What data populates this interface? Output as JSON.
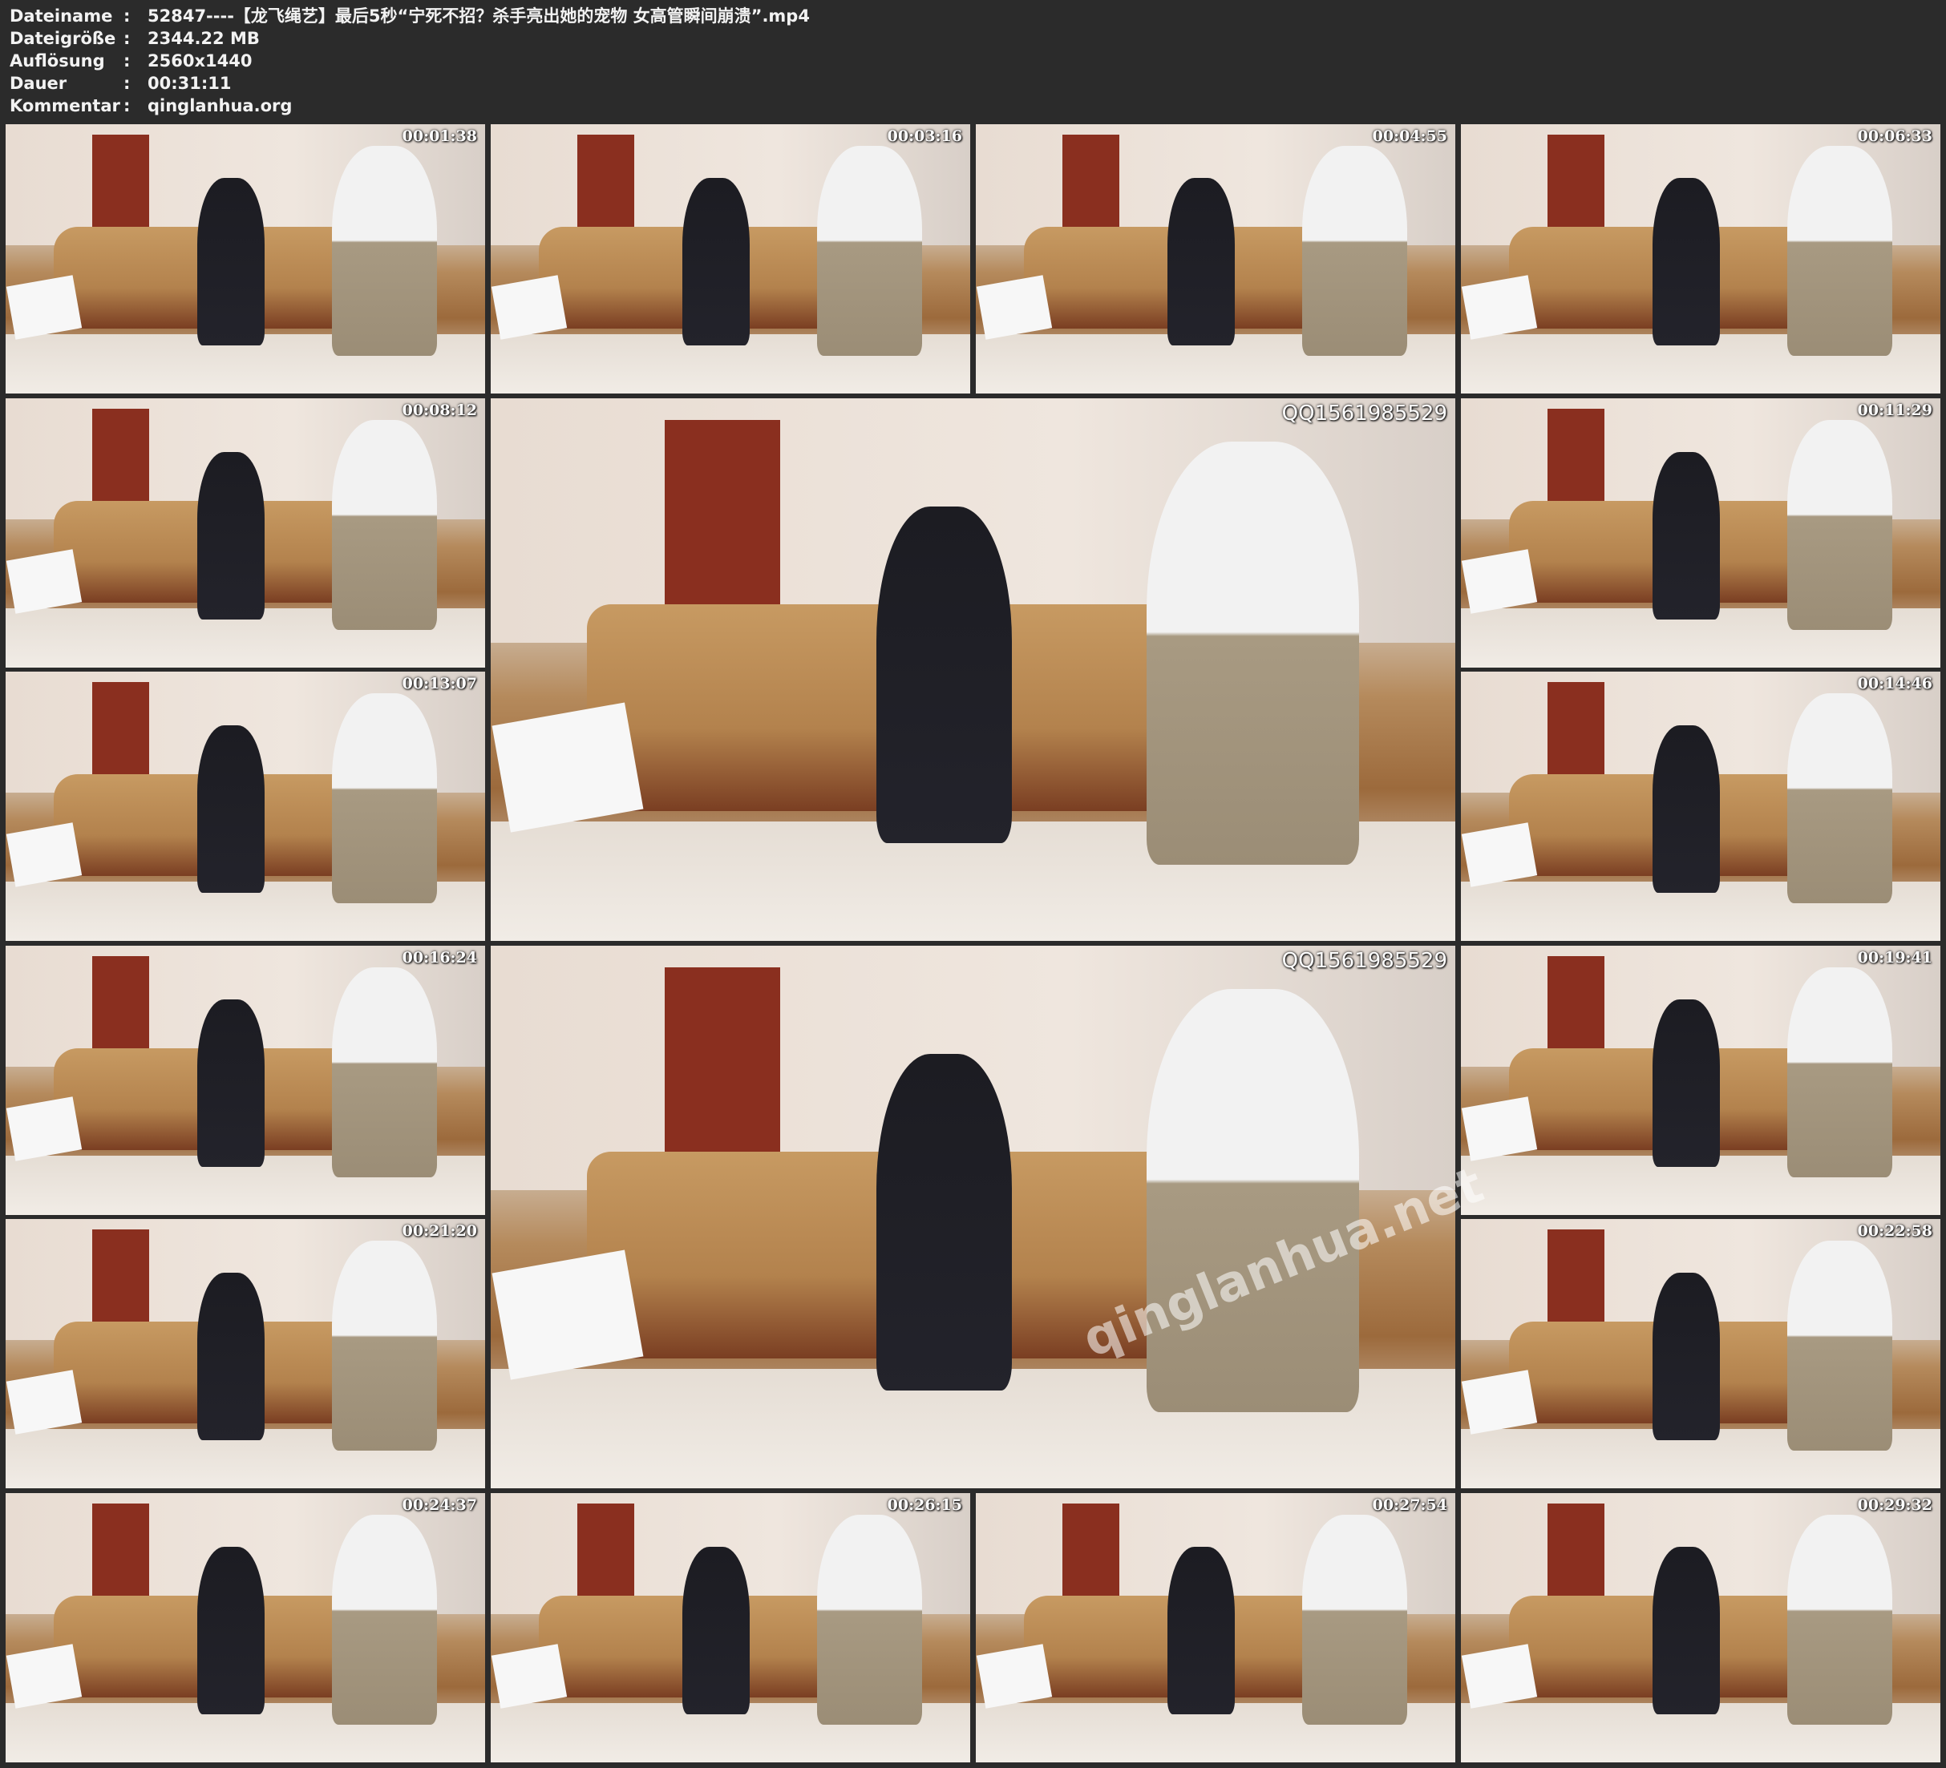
{
  "info": {
    "rows": [
      {
        "key": "Dateiname",
        "value": "52847----【龙飞绳艺】最后5秒“宁死不招？杀手亮出她的宠物 女高管瞬间崩溃”.mp4"
      },
      {
        "key": "Dateigröße",
        "value": "2344.22 MB"
      },
      {
        "key": "Auflösung",
        "value": "2560x1440"
      },
      {
        "key": "Dauer",
        "value": "00:31:11"
      },
      {
        "key": "Kommentar",
        "value": "qinglanhua.org"
      }
    ],
    "separator": ":"
  },
  "thumbnails": [
    {
      "timestamp": "00:01:38"
    },
    {
      "timestamp": "00:03:16"
    },
    {
      "timestamp": "00:04:55"
    },
    {
      "timestamp": "00:06:33"
    },
    {
      "timestamp": "00:08:12"
    },
    {
      "timestamp": "QQ1561985529"
    },
    {
      "timestamp": "00:11:29"
    },
    {
      "timestamp": "00:13:07"
    },
    {
      "timestamp": "00:14:46"
    },
    {
      "timestamp": "00:16:24"
    },
    {
      "timestamp": "QQ1561985529"
    },
    {
      "timestamp": "00:19:41"
    },
    {
      "timestamp": "00:21:20"
    },
    {
      "timestamp": "00:22:58"
    },
    {
      "timestamp": "00:24:37"
    },
    {
      "timestamp": "00:26:15"
    },
    {
      "timestamp": "00:27:54"
    },
    {
      "timestamp": "00:29:32"
    }
  ],
  "watermark": "qinglanhua.net"
}
